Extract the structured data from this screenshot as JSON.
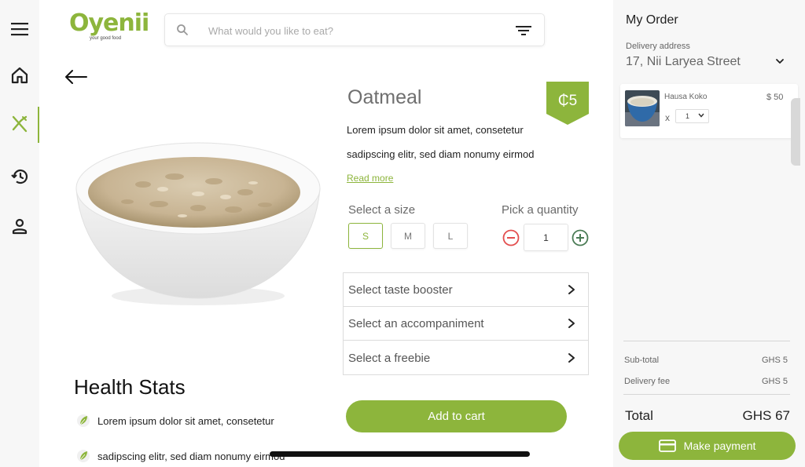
{
  "app": {
    "logo_text": "Oyenii",
    "logo_tagline": "your good food",
    "brand_color": "#8db53c"
  },
  "nav": {
    "items": [
      {
        "icon": "menu-icon"
      },
      {
        "icon": "home-icon"
      },
      {
        "icon": "fork-knife-icon",
        "active": true
      },
      {
        "icon": "history-icon"
      },
      {
        "icon": "profile-icon"
      }
    ]
  },
  "search": {
    "placeholder": "What would you like to eat?"
  },
  "product": {
    "name": "Oatmeal",
    "price": "₵5",
    "description_line1": "Lorem ipsum dolor sit amet, consetetur",
    "description_line2": "sadipscing elitr, sed diam nonumy eirmod",
    "read_more": "Read more",
    "size_label": "Select a size",
    "sizes": [
      "S",
      "M",
      "L"
    ],
    "selected_size": "S",
    "quantity_label": "Pick a quantity",
    "quantity": "1",
    "options": [
      "Select taste booster",
      "Select an accompaniment",
      "Select a freebie"
    ],
    "add_to_cart": "Add to cart"
  },
  "health": {
    "title": "Health Stats",
    "items": [
      "Lorem ipsum dolor sit amet, consetetur",
      "sadipscing elitr, sed diam nonumy eirmod"
    ]
  },
  "order": {
    "title": "My Order",
    "delivery_label": "Delivery address",
    "delivery_address": "17, Nii Laryea Street",
    "items": [
      {
        "name": "Hausa Koko",
        "price": "$ 50",
        "x": "x",
        "qty": "1"
      }
    ],
    "subtotal_label": "Sub-total",
    "subtotal_value": "GHS 5",
    "delivery_fee_label": "Delivery fee",
    "delivery_fee_value": "GHS 5",
    "total_label": "Total",
    "total_value": "GHS 67",
    "pay_button": "Make payment"
  }
}
